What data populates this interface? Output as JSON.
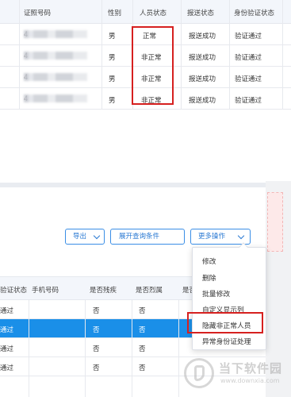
{
  "top_table": {
    "headers": [
      "证照号码",
      "性别",
      "人员状态",
      "报送状态",
      "身份验证状态"
    ],
    "rows": [
      {
        "id_prefix": "4",
        "gender": "男",
        "status": "正常",
        "report": "报送成功",
        "verify": "验证通过"
      },
      {
        "id_prefix": "4",
        "gender": "男",
        "status": "非正常",
        "report": "报送成功",
        "verify": "验证通过"
      },
      {
        "id_prefix": "4",
        "gender": "男",
        "status": "非正常",
        "report": "报送成功",
        "verify": "验证通过"
      },
      {
        "id_prefix": "4",
        "gender": "男",
        "status": "非正常",
        "report": "报送成功",
        "verify": "验证通过"
      }
    ]
  },
  "toolbar": {
    "export_label": "导出",
    "expand_query_label": "展开查询条件",
    "more_ops_label": "更多操作"
  },
  "dropdown": {
    "items": [
      "修改",
      "删除",
      "批量修改",
      "自定义显示列",
      "隐藏非正常人员",
      "异常身份证处理"
    ]
  },
  "bottom_table": {
    "headers": [
      "验证状态",
      "手机号码",
      "是否残疾",
      "是否烈属",
      "是否"
    ],
    "rows": [
      {
        "verify": "通过",
        "disabled": "否",
        "martyr": "否",
        "selected": false
      },
      {
        "verify": "通过",
        "disabled": "否",
        "martyr": "否",
        "selected": true
      },
      {
        "verify": "通过",
        "disabled": "否",
        "martyr": "否",
        "selected": false
      },
      {
        "verify": "通过",
        "disabled": "否",
        "martyr": "否",
        "selected": false
      }
    ]
  },
  "watermark": {
    "title": "当下软件园",
    "url": "www.downxia.com"
  },
  "colors": {
    "accent": "#1a8fe8",
    "highlight_red": "#d6201f",
    "header_bg": "#f3f6fb"
  }
}
